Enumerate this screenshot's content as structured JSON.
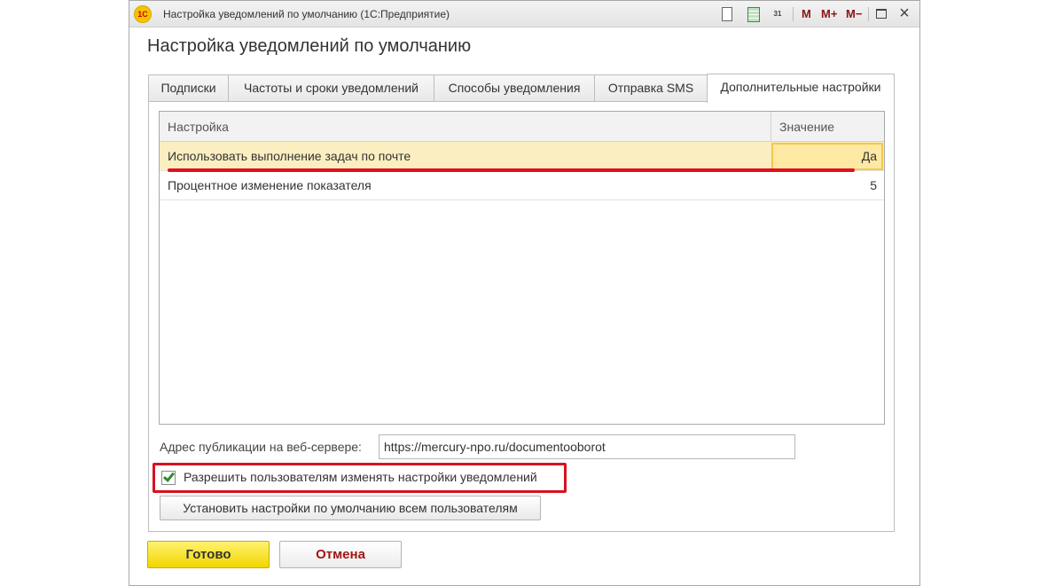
{
  "window": {
    "title": "Настройка уведомлений по умолчанию  (1С:Предприятие)",
    "logo_text": "1С",
    "toolbar": {
      "calendar_day": "31",
      "m_label": "M",
      "m_plus_label": "M+",
      "m_minus_label": "M−",
      "close_glyph": "×"
    }
  },
  "form": {
    "title": "Настройка уведомлений по умолчанию"
  },
  "tabs": [
    {
      "label": "Подписки"
    },
    {
      "label": "Частоты и сроки уведомлений"
    },
    {
      "label": "Способы уведомления"
    },
    {
      "label": "Отправка SMS"
    },
    {
      "label": "Дополнительные настройки",
      "active": true
    }
  ],
  "table": {
    "columns": [
      "Настройка",
      "Значение"
    ],
    "rows": [
      {
        "name": "Использовать выполнение задач по почте",
        "value": "Да",
        "selected": true
      },
      {
        "name": "Процентное изменение показателя",
        "value": "5"
      }
    ]
  },
  "publication": {
    "label": "Адрес публикации на веб-сервере:",
    "value": "https://mercury-npo.ru/documentooborot"
  },
  "allow_users": {
    "label": "Разрешить пользователям изменять настройки уведомлений",
    "checked": true
  },
  "buttons": {
    "set_defaults": "Установить настройки по умолчанию всем пользователям",
    "ok": "Готово",
    "cancel": "Отмена"
  },
  "colors": {
    "highlight": "#e0101e",
    "selected_row": "#fbeec0",
    "ok_button": "#f2d600",
    "cancel_text": "#a31414"
  }
}
